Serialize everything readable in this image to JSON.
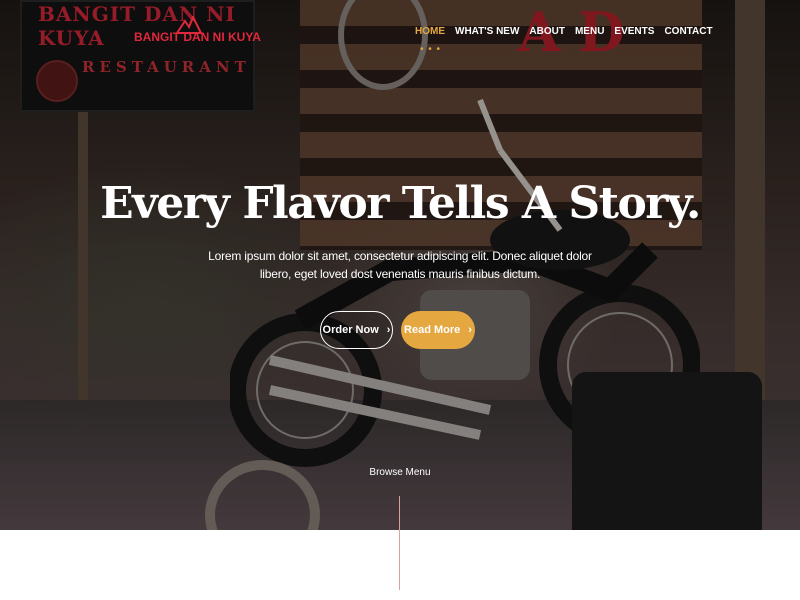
{
  "brand": {
    "logo_text": "BANGIT DAN NI KUYA",
    "sign_top_text": "BANGIT DAN NI KUYA",
    "sign_bottom_text": "RESTAURANT"
  },
  "nav": {
    "items": [
      {
        "label": "HOME",
        "active": true
      },
      {
        "label": "WHAT'S NEW",
        "active": false
      },
      {
        "label": "ABOUT",
        "active": false
      },
      {
        "label": "MENU",
        "active": false
      },
      {
        "label": "EVENTS",
        "active": false
      },
      {
        "label": "CONTACT",
        "active": false
      }
    ],
    "active_indicator": "• • •"
  },
  "hero": {
    "headline": "Every Flavor Tells A Story.",
    "subtext": "Lorem ipsum dolor sit amet, consectetur adipiscing elit. Donec aliquet dolor libero, eget loved dost venenatis mauris finibus dictum.",
    "order_button_label": "Order Now",
    "read_button_label": "Read More",
    "button_icon": "chevron-right-icon",
    "browse_label": "Browse Menu"
  },
  "colors": {
    "accent": "#e5a841",
    "logo_red": "#e0283c",
    "text": "#ffffff"
  }
}
